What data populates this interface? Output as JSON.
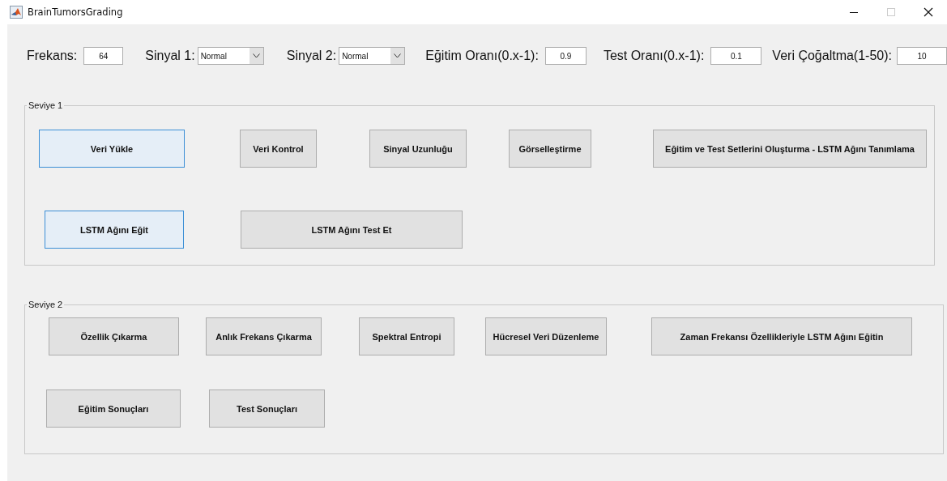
{
  "window": {
    "title": "BrainTumorsGrading"
  },
  "parameters": [
    {
      "kind": "input",
      "label": "Frekans:",
      "value": "64"
    },
    {
      "kind": "select",
      "label": "Sinyal 1:",
      "value": "Normal"
    },
    {
      "kind": "select",
      "label": "Sinyal 2:",
      "value": "Normal"
    },
    {
      "kind": "input",
      "label": "Eğitim Oranı(0.x-1):",
      "value": "0.9"
    },
    {
      "kind": "input",
      "label": "Test Oranı(0.x-1):",
      "value": "0.1"
    },
    {
      "kind": "input",
      "label": "Veri Çoğaltma(1-50):",
      "value": "10"
    }
  ],
  "panels": [
    {
      "title": "Seviye 1",
      "rows": [
        [
          {
            "label": "Veri Yükle",
            "highlighted": true
          },
          {
            "label": "Veri Kontrol",
            "highlighted": false
          },
          {
            "label": "Sinyal Uzunluğu",
            "highlighted": false
          },
          {
            "label": "Görselleştirme",
            "highlighted": false
          },
          {
            "label": "Eğitim ve Test Setlerini Oluşturma - LSTM Ağını Tanımlama",
            "highlighted": false
          }
        ],
        [
          {
            "label": "LSTM Ağını Eğit",
            "highlighted": true
          },
          {
            "label": "LSTM Ağını Test Et",
            "highlighted": false
          }
        ]
      ]
    },
    {
      "title": "Seviye 2",
      "rows": [
        [
          {
            "label": "Özellik Çıkarma",
            "highlighted": false
          },
          {
            "label": "Anlık Frekans Çıkarma",
            "highlighted": false
          },
          {
            "label": "Spektral Entropi",
            "highlighted": false
          },
          {
            "label": "Hücresel Veri Düzenleme",
            "highlighted": false
          },
          {
            "label": "Zaman Frekansı Özellikleriyle LSTM Ağını Eğitin",
            "highlighted": false
          }
        ],
        [
          {
            "label": "Eğitim Sonuçları",
            "highlighted": false
          },
          {
            "label": "Test Sonuçları",
            "highlighted": false
          }
        ]
      ]
    }
  ]
}
